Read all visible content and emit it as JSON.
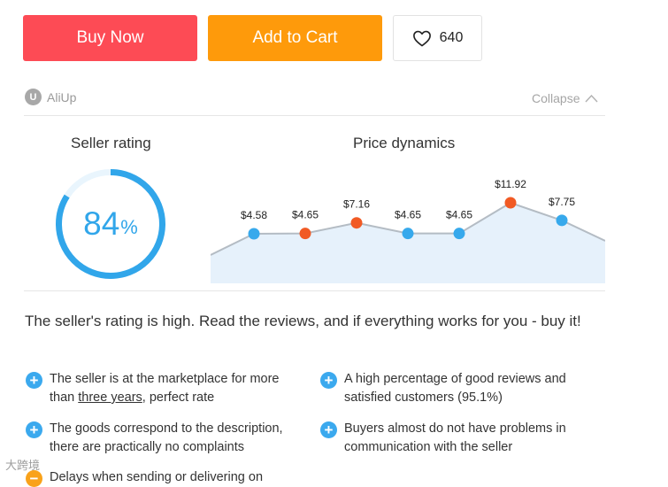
{
  "actions": {
    "buy_label": "Buy Now",
    "cart_label": "Add to Cart",
    "wishlist_count": "640"
  },
  "aliup": {
    "logo_letter": "U",
    "brand": "AliUp",
    "collapse_label": "Collapse"
  },
  "seller_rating": {
    "title": "Seller rating",
    "value": "84",
    "percent_sign": "%",
    "fraction": 0.84,
    "color": "#31a6ea"
  },
  "price_dynamics": {
    "title": "Price dynamics"
  },
  "chart_data": {
    "type": "area",
    "values": [
      4.58,
      4.65,
      7.16,
      4.65,
      4.65,
      11.92,
      7.75
    ],
    "labels": [
      "$4.58",
      "$4.65",
      "$7.16",
      "$4.65",
      "$4.65",
      "$11.92",
      "$7.75"
    ],
    "marker_colors": [
      "#37a9ec",
      "#f15a24",
      "#f15a24",
      "#37a9ec",
      "#37a9ec",
      "#f15a24",
      "#37a9ec"
    ],
    "line_color": "#b4bcc4",
    "fill_color": "#e6f1fb"
  },
  "summary": "The seller's rating is high. Read the reviews, and if everything works for you - buy it!",
  "features": [
    {
      "line1": "The seller is at the marketplace for more",
      "line2_pre": "than ",
      "line2_link": "three years",
      "line2_post": ", perfect rate",
      "icon": "plus-circle-icon"
    },
    {
      "line1": "A high percentage of good reviews and",
      "line2": "satisfied customers (95.1%)",
      "icon": "plus-circle-icon"
    },
    {
      "line1": "The goods correspond to the description,",
      "line2": "there are practically no complaints",
      "icon": "plus-circle-icon"
    },
    {
      "line1": "Buyers almost do not have problems in",
      "line2": "communication with the seller",
      "icon": "plus-circle-icon"
    },
    {
      "line1": "Delays when sending or delivering on",
      "icon": "minus-circle-icon"
    }
  ],
  "watermark": "大跨境"
}
